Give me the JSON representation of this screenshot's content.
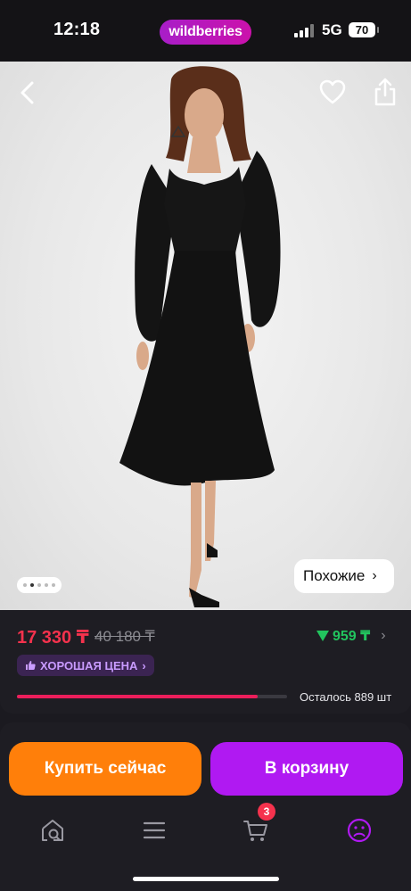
{
  "status_bar": {
    "time": "12:18",
    "brand": "wildberries",
    "network": "5G",
    "battery": "70"
  },
  "gallery": {
    "image_count": 5,
    "active_index": 2,
    "similar_label": "Похожие",
    "similar_chevron": "›"
  },
  "price": {
    "current": "17 330 ₸",
    "old": "40 180 ₸",
    "cashback": "959 ₸",
    "cashback_chevron": "›",
    "badge": "ХОРОШАЯ ЦЕНА",
    "badge_chevron": "›",
    "stock_fraction": 0.89,
    "remaining": "Осталось 889 шт"
  },
  "actions": {
    "buy_now": "Купить сейчас",
    "add_to_cart": "В корзину"
  },
  "tabbar": {
    "items": [
      "home-search-icon",
      "menu-icon",
      "cart-icon",
      "profile-icon"
    ],
    "cart_count": "3"
  },
  "colors": {
    "accent_purple": "#b019f2",
    "buy_orange": "#ff7f0a",
    "price_red": "#f5324d",
    "cashback_green": "#22c55e"
  }
}
